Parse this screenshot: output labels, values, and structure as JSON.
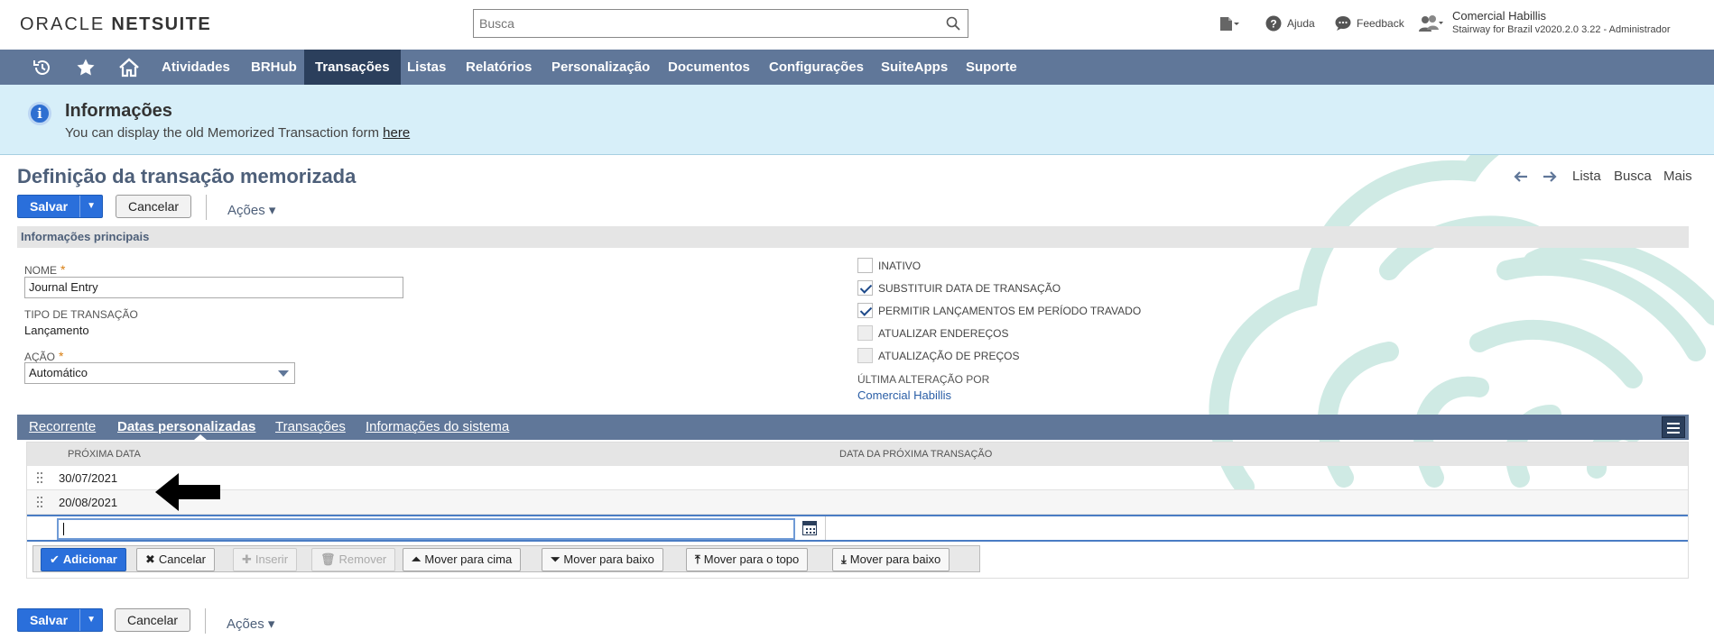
{
  "header": {
    "logo_part1": "ORACLE",
    "logo_part2": "NETSUITE",
    "search_placeholder": "Busca",
    "help_label": "Ajuda",
    "feedback_label": "Feedback",
    "user_name": "Comercial Habillis",
    "user_role": "Stairway for Brazil v2020.2.0 3.22 - Administrador"
  },
  "nav": {
    "items": [
      {
        "label": "Atividades"
      },
      {
        "label": "BRHub"
      },
      {
        "label": "Transações"
      },
      {
        "label": "Listas"
      },
      {
        "label": "Relatórios"
      },
      {
        "label": "Personalização"
      },
      {
        "label": "Documentos"
      },
      {
        "label": "Configurações"
      },
      {
        "label": "SuiteApps"
      },
      {
        "label": "Suporte"
      }
    ],
    "active": "Transações"
  },
  "info": {
    "title": "Informações",
    "text": "You can display the old Memorized Transaction form ",
    "link": "here"
  },
  "page": {
    "title": "Definição da transação memorizada",
    "nav_list": "Lista",
    "nav_search": "Busca",
    "nav_more": "Mais",
    "save_label": "Salvar",
    "cancel_label": "Cancelar",
    "actions_label": "Ações ▾"
  },
  "section": {
    "title": "Informações principais"
  },
  "fields": {
    "name_label": "Nome",
    "name_value": "Journal Entry",
    "type_label": "Tipo de transação",
    "type_value": "Lançamento",
    "action_label": "Ação",
    "action_value": "Automático",
    "inactive_label": "Inativo",
    "inactive_checked": false,
    "replace_date_label": "Substituir data de transação",
    "replace_date_checked": true,
    "allow_locked_label": "Permitir lançamentos em período travado",
    "allow_locked_checked": true,
    "update_addresses_label": "Atualizar endereços",
    "update_prices_label": "Atualização de preços",
    "last_changed_label": "Última alteração por",
    "last_changed_value": "Comercial Habillis"
  },
  "tabs": [
    {
      "label": "Recorrente"
    },
    {
      "label": "Datas personalizadas"
    },
    {
      "label": "Transações"
    },
    {
      "label": "Informações do sistema"
    }
  ],
  "sublist": {
    "col_next_date": "Próxima data",
    "col_next_tx_date": "Data da próxima transação",
    "rows": [
      {
        "next_date": "30/07/2021"
      },
      {
        "next_date": "20/08/2021"
      }
    ],
    "buttons": {
      "add": "Adicionar",
      "cancel": "Cancelar",
      "insert": "Inserir",
      "remove": "Remover",
      "move_up": "Mover para cima",
      "move_down": "Mover para baixo",
      "move_top": "Mover para o topo",
      "move_bottom": "Mover para baixo"
    }
  },
  "colors": {
    "nav_bg": "#607799",
    "nav_active": "#2b3f5c",
    "primary_button": "#2a6fdb",
    "info_bg": "#d7eff9",
    "title_color": "#4d5f79"
  }
}
